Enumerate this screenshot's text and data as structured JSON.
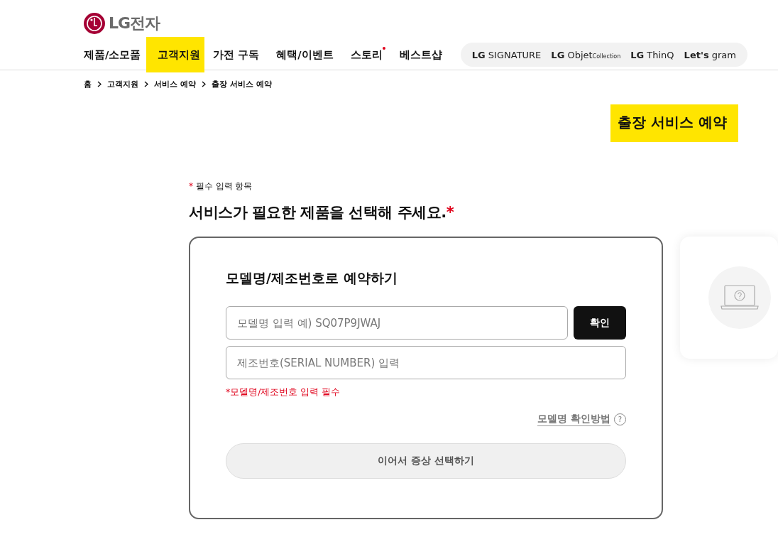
{
  "logo": {
    "text": "LG전자"
  },
  "nav": [
    {
      "label": "제품/소모품",
      "selected": false,
      "new_dot": false
    },
    {
      "label": "고객지원",
      "selected": true,
      "new_dot": false
    },
    {
      "label": "가전 구독",
      "selected": false,
      "new_dot": false
    },
    {
      "label": "혜택/이벤트",
      "selected": false,
      "new_dot": false
    },
    {
      "label": "스토리",
      "selected": false,
      "new_dot": true
    },
    {
      "label": "베스트샵",
      "selected": false,
      "new_dot": false
    }
  ],
  "brands": [
    {
      "prefix": "LG",
      "name": "SIGNATURE"
    },
    {
      "prefix": "LG",
      "name": "Objet",
      "suffix": "Collection"
    },
    {
      "prefix": "LG",
      "name": "ThinQ"
    },
    {
      "prefix": "Let's",
      "name": "gram"
    }
  ],
  "breadcrumb": [
    "홈",
    "고객지원",
    "서비스 예약",
    "출장 서비스 예약"
  ],
  "page_title": {
    "text": "출장 서비스 예약",
    "highlighted": true
  },
  "required_note": {
    "mark": "*",
    "text": "필수 입력 항목"
  },
  "section_heading": {
    "text": "서비스가 필요한 제품을 선택해 주세요.",
    "mark": "*"
  },
  "form": {
    "title": "모델명/제조번호로 예약하기",
    "model_field": {
      "placeholder": "모델명 입력 예) SQ07P9JWAJ"
    },
    "confirm_button": "확인",
    "serial_field": {
      "placeholder": "제조번호(SERIAL NUMBER) 입력"
    },
    "error": "*모델명/제조번호 입력 필수",
    "help_link": "모델명 확인방법",
    "help_icon": "?",
    "next_button": {
      "label": "이어서 증상 선택하기",
      "disabled": true
    }
  }
}
